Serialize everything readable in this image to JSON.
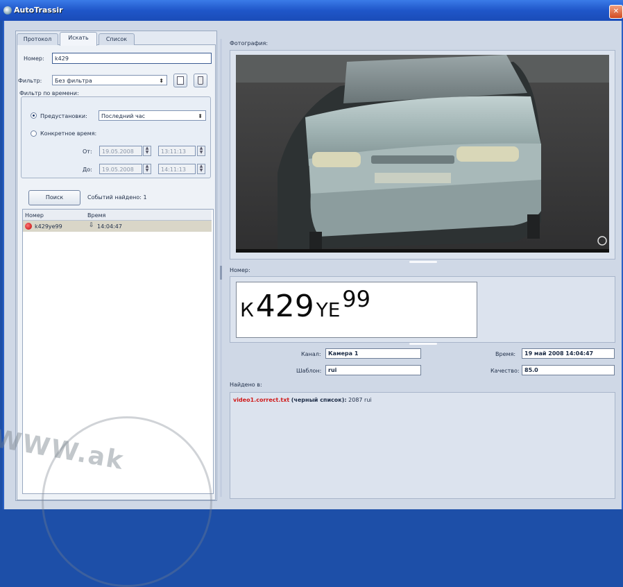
{
  "window": {
    "title": "AutoTrassir"
  },
  "tabs": [
    {
      "label": "Протокол"
    },
    {
      "label": "Искать"
    },
    {
      "label": "Список"
    }
  ],
  "search": {
    "number_label": "Номер:",
    "number_value": "k429",
    "filter_label": "Фильтр:",
    "filter_value": "Без фильтра",
    "time_group_title": "Фильтр по времени:",
    "preset_label": "Предустановки:",
    "preset_value": "Последний час",
    "specific_label": "Конкретное время:",
    "from_label": "От:",
    "from_date": "19.05.2008",
    "from_time": "13:11:13",
    "to_label": "До:",
    "to_date": "19.05.2008",
    "to_time": "14:11:13",
    "search_button": "Поиск",
    "found_text": "Событий найдено: 1"
  },
  "results": {
    "columns": [
      "Номер",
      "Время"
    ],
    "rows": [
      {
        "number": "k429ye99",
        "time": "14:04:47"
      }
    ]
  },
  "photo": {
    "section_label": "Фотография:"
  },
  "plate": {
    "section_label": "Номер:",
    "letter1": "К",
    "digits": "429",
    "letters": "YE",
    "region": "99"
  },
  "info": {
    "channel_label": "Канал:",
    "channel_value": "Камера 1",
    "template_label": "Шаблон:",
    "template_value": "rui",
    "time_label": "Время:",
    "time_value": "19 май 2008 14:04:47",
    "quality_label": "Качество:",
    "quality_value": "85.0"
  },
  "found_in": {
    "section_label": "Найдено в:",
    "file": "video1.correct.txt",
    "list": "(черный список):",
    "rest": "2087 rui"
  },
  "watermark": {
    "text": "WWW.ak"
  }
}
